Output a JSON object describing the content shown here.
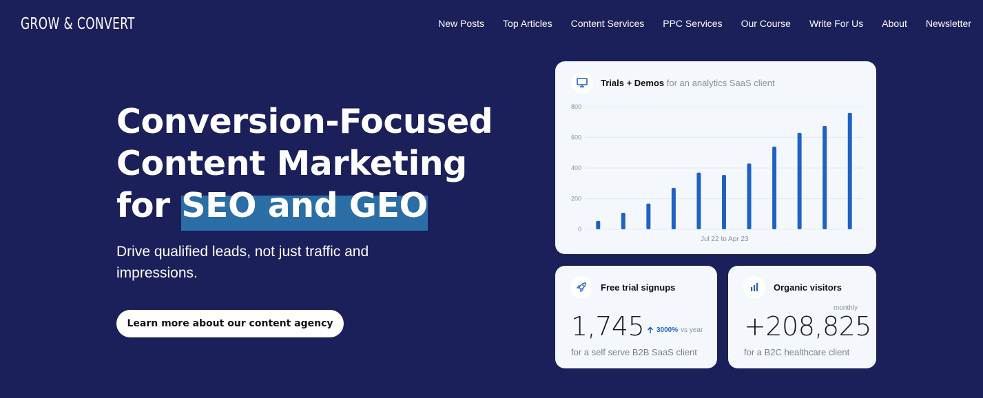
{
  "brand": {
    "logo": "GROW & CONVERT"
  },
  "nav": {
    "items": [
      "New Posts",
      "Top Articles",
      "Content Services",
      "PPC Services",
      "Our Course",
      "Write For Us",
      "About",
      "Newsletter"
    ]
  },
  "hero": {
    "title_line1": "Conversion-Focused",
    "title_line2": "Content Marketing",
    "title_line3_prefix": "for ",
    "title_line3_highlight": "SEO and GEO",
    "subtitle": "Drive qualified leads, not just traffic and impressions.",
    "cta_label": "Learn more about our content agency"
  },
  "colors": {
    "background": "#1b1f5a",
    "highlight": "#2b6ea6",
    "bar": "#1e63c4",
    "card": "#f4f8fd"
  },
  "trials_card": {
    "icon": "monitor-icon",
    "title": "Trials + Demos",
    "subtitle": "for an analytics SaaS client",
    "period_label": "Jul 22 to Apr 23"
  },
  "chart_data": {
    "type": "bar",
    "title": "Trials + Demos",
    "subtitle": "for an analytics SaaS client",
    "xlabel": "Jul 22 to Apr 23",
    "ylabel": "",
    "ylim": [
      0,
      800
    ],
    "yticks": [
      0,
      200,
      400,
      600,
      800
    ],
    "grid": true,
    "values": [
      55,
      108,
      168,
      270,
      370,
      355,
      430,
      540,
      630,
      675,
      760
    ]
  },
  "signups_card": {
    "icon": "rocket-icon",
    "title": "Free trial signups",
    "value": "1,745",
    "growth_pct": "3000%",
    "growth_suffix": "vs year",
    "note": "for a self serve B2B SaaS client"
  },
  "visitors_card": {
    "icon": "bar-chart-icon",
    "title": "Organic visitors",
    "period": "monthly",
    "value": "+208,825",
    "note": "for a B2C healthcare client"
  }
}
